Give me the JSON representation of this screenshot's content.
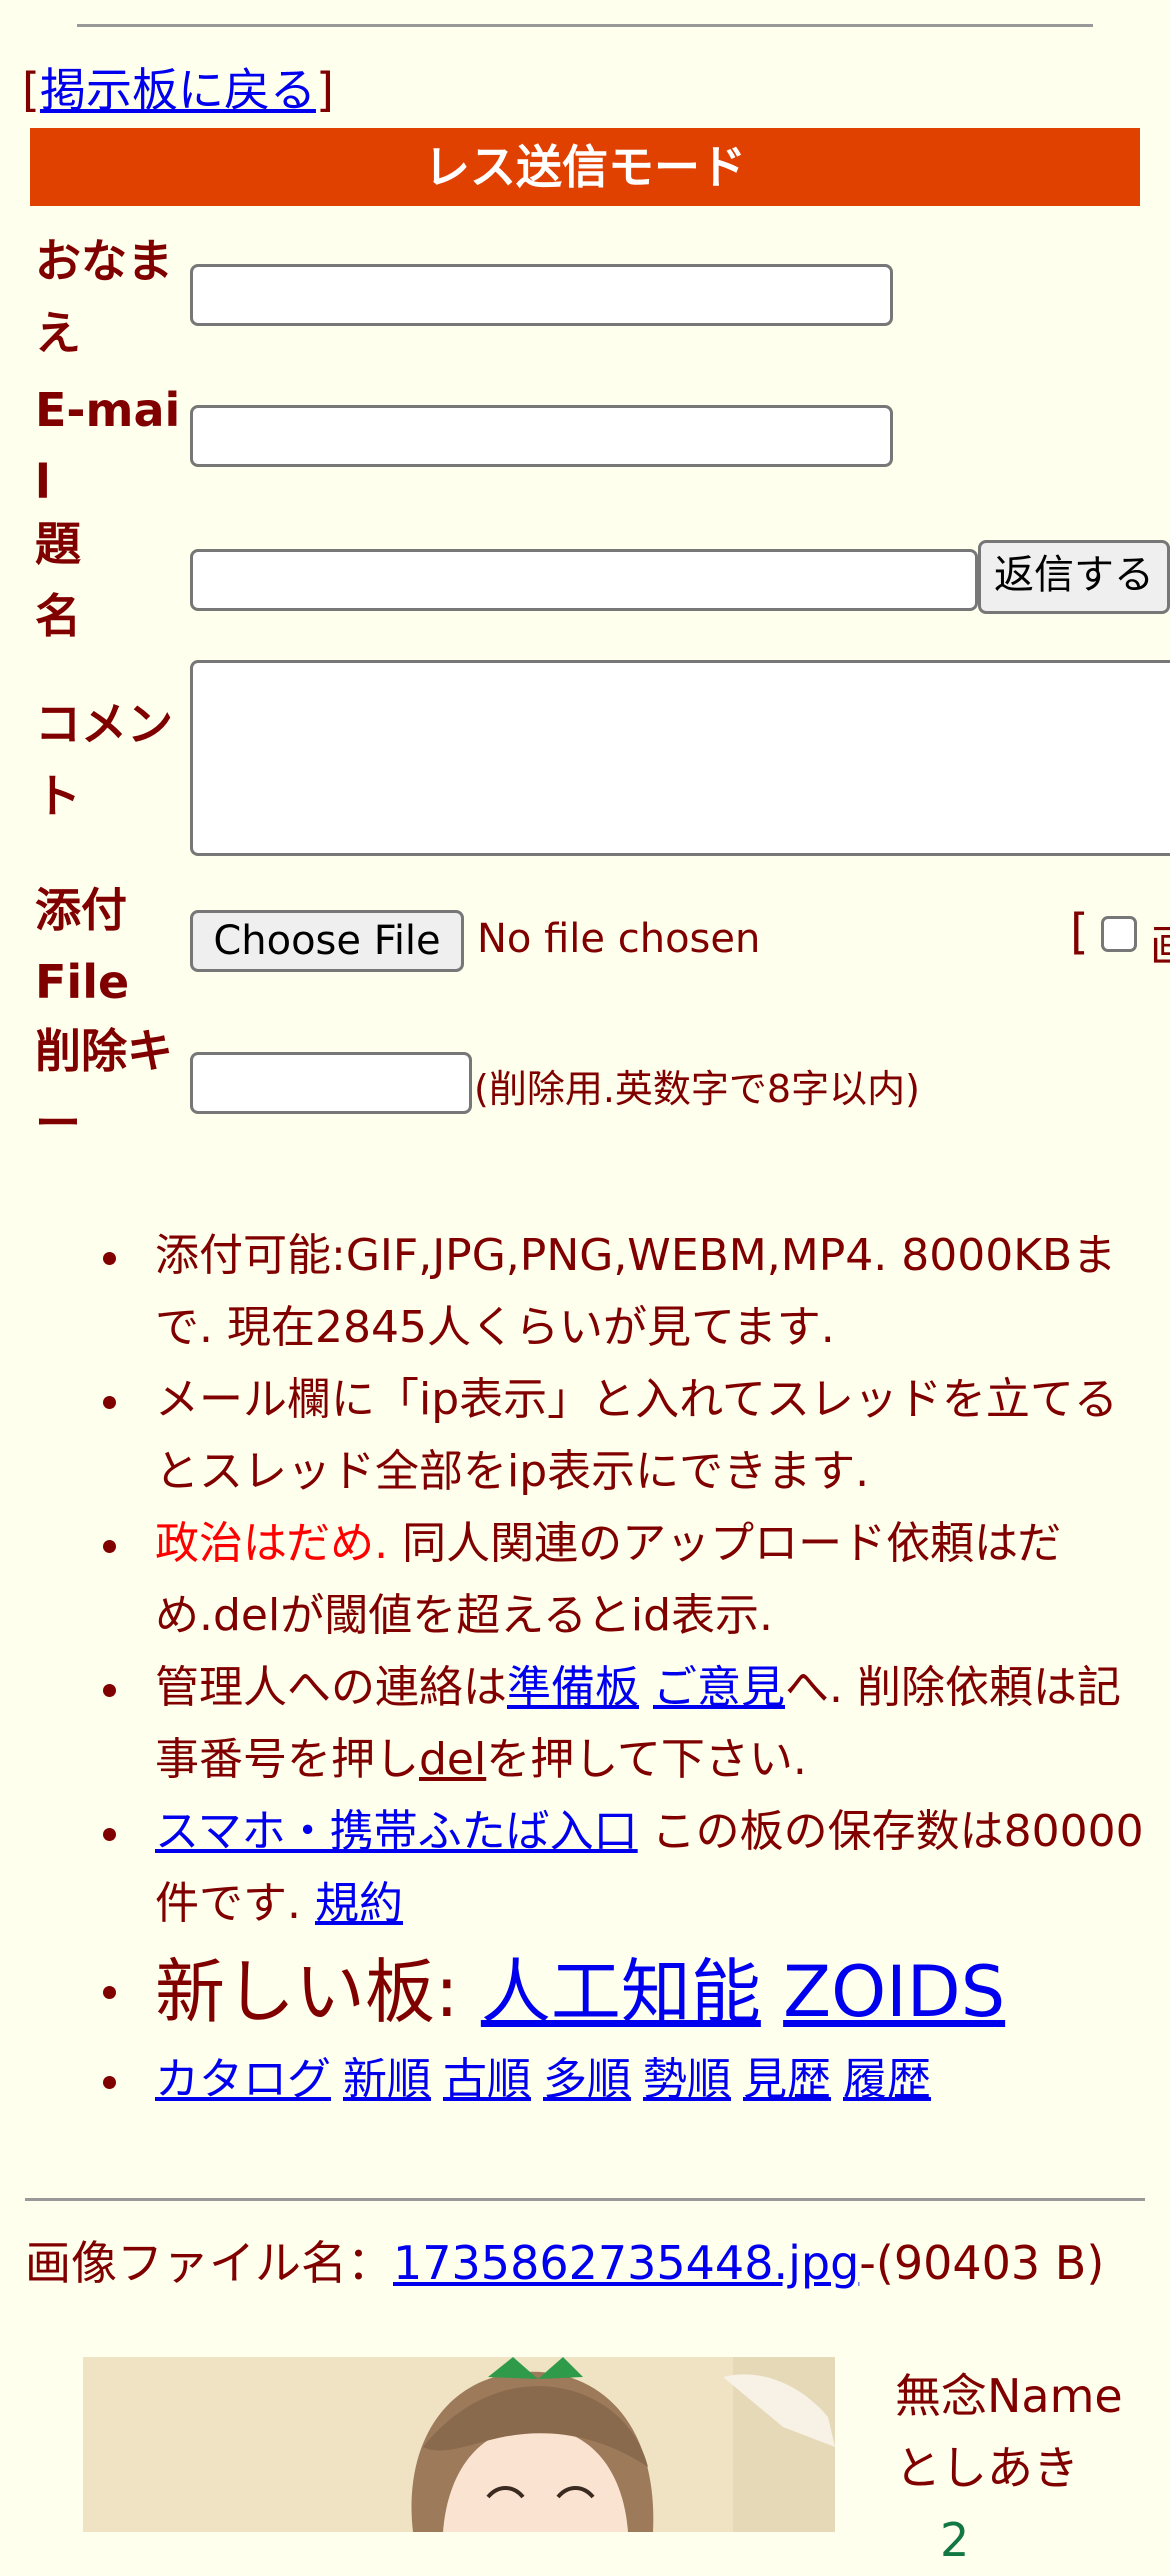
{
  "nav": {
    "bracket_open": "[",
    "back_link": "掲示板に戻る",
    "bracket_close": "]"
  },
  "form": {
    "banner": "レス送信モード",
    "name_label": "おなまえ",
    "email_label": "E-mail",
    "subject_label": "題名",
    "comment_label": "コメント",
    "file_label": "添付File",
    "delkey_label": "削除キー",
    "submit_label": "返信する",
    "choose_file_label": "Choose File",
    "no_file_text": "No file chosen",
    "checkbox_bracket": "[",
    "checkbox_partial_label": "画",
    "delkey_hint": "(削除用.英数字で8字以内)"
  },
  "notes": {
    "n1": "添付可能:GIF,JPG,PNG,WEBM,MP4. 8000KBまで. 現在2845人くらいが見てます.",
    "n2": "メール欄に「ip表示」と入れてスレッドを立てるとスレッド全部をip表示にできます.",
    "n3_red": "政治はだめ.",
    "n3_rest": " 同人関連のアップロード依頼はだめ.delが閾値を超えるとid表示.",
    "n4_a": "管理人への連絡は",
    "n4_link1": "準備板",
    "n4_link2": "ご意見",
    "n4_b": "へ. 削除依頼は記事番号を押し",
    "n4_del": "del",
    "n4_c": "を押して下さい.",
    "n5_link": "スマホ・携帯ふたば入口",
    "n5_text": " この板の保存数は80000件です. ",
    "n5_terms": "規約",
    "n6_prefix": "新しい板: ",
    "n6_link1": "人工知能",
    "n6_link2": "ZOIDS",
    "sort_links": [
      "カタログ",
      "新順",
      "古順",
      "多順",
      "勢順",
      "見歴",
      "履歴"
    ]
  },
  "post": {
    "file_prefix": "画像ファイル名：",
    "file_link": "1735862735448.jpg",
    "file_size": "-(90403 B)",
    "poster_line1": "無念Name",
    "poster_line2": "としあき",
    "poster_line3": "2"
  },
  "colors": {
    "background": "#ffffee",
    "text": "#800000",
    "banner": "#e04000",
    "link": "#0000ee",
    "warning": "#ff0000"
  }
}
